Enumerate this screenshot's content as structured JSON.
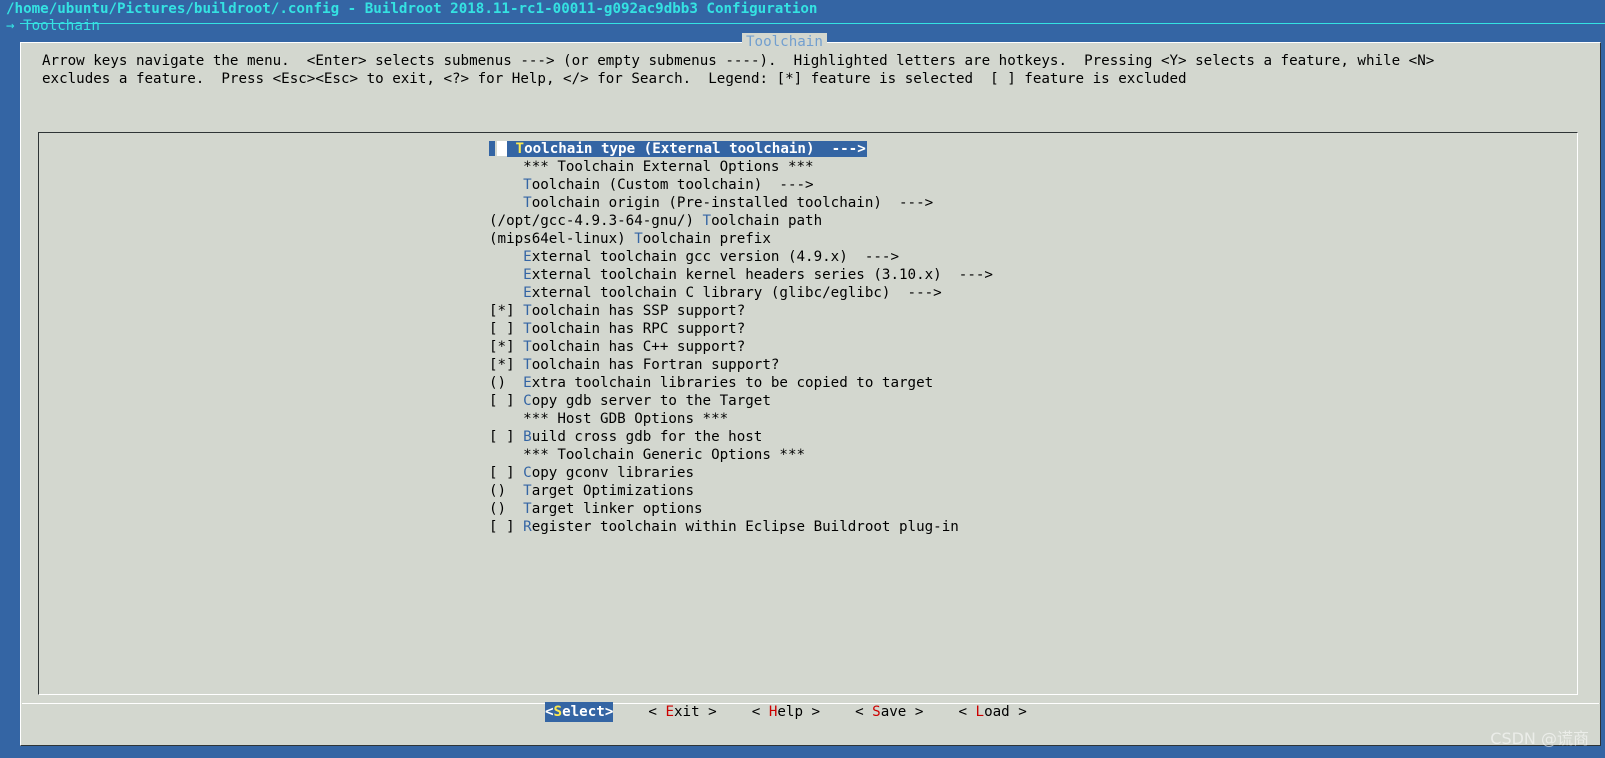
{
  "window": {
    "title": "/home/ubuntu/Pictures/buildroot/.config - Buildroot 2018.11-rc1-00011-g092ac9dbb3 Configuration",
    "breadcrumb": "→ Toolchain"
  },
  "dialog": {
    "title": "Toolchain",
    "help_line_1": "Arrow keys navigate the menu.  <Enter> selects submenus ---> (or empty submenus ----).  Highlighted letters are hotkeys.  Pressing <Y> selects a feature, while <N>",
    "help_line_2": "excludes a feature.  Press <Esc><Esc> to exit, <?> for Help, </> for Search.  Legend: [*] feature is selected  [ ] feature is excluded"
  },
  "menu": {
    "items": [
      {
        "prefix": "    ",
        "hotkey": "T",
        "rest": "oolchain type (External toolchain)  --->",
        "selected": true
      },
      {
        "prefix": "    ",
        "hotkey": "",
        "rest": "*** Toolchain External Options ***"
      },
      {
        "prefix": "    ",
        "hotkey": "T",
        "rest": "oolchain (Custom toolchain)  --->"
      },
      {
        "prefix": "    ",
        "hotkey": "T",
        "rest": "oolchain origin (Pre-installed toolchain)  --->"
      },
      {
        "prefix": "(/opt/gcc-4.9.3-64-gnu/) ",
        "hotkey": "T",
        "rest": "oolchain path"
      },
      {
        "prefix": "(mips64el-linux) ",
        "hotkey": "T",
        "rest": "oolchain prefix"
      },
      {
        "prefix": "    ",
        "hotkey": "E",
        "rest": "xternal toolchain gcc version (4.9.x)  --->"
      },
      {
        "prefix": "    ",
        "hotkey": "E",
        "rest": "xternal toolchain kernel headers series (3.10.x)  --->"
      },
      {
        "prefix": "    ",
        "hotkey": "E",
        "rest": "xternal toolchain C library (glibc/eglibc)  --->"
      },
      {
        "prefix": "[*] ",
        "hotkey": "T",
        "rest": "oolchain has SSP support?"
      },
      {
        "prefix": "[ ] ",
        "hotkey": "T",
        "rest": "oolchain has RPC support?"
      },
      {
        "prefix": "[*] ",
        "hotkey": "T",
        "rest": "oolchain has C++ support?"
      },
      {
        "prefix": "[*] ",
        "hotkey": "T",
        "rest": "oolchain has Fortran support?"
      },
      {
        "prefix": "()  ",
        "hotkey": "E",
        "rest": "xtra toolchain libraries to be copied to target"
      },
      {
        "prefix": "[ ] ",
        "hotkey": "C",
        "rest": "opy gdb server to the Target"
      },
      {
        "prefix": "    ",
        "hotkey": "",
        "rest": "*** Host GDB Options ***"
      },
      {
        "prefix": "[ ] ",
        "hotkey": "B",
        "rest": "uild cross gdb for the host"
      },
      {
        "prefix": "    ",
        "hotkey": "",
        "rest": "*** Toolchain Generic Options ***"
      },
      {
        "prefix": "[ ] ",
        "hotkey": "C",
        "rest": "opy gconv libraries"
      },
      {
        "prefix": "()  ",
        "hotkey": "T",
        "rest": "arget Optimizations"
      },
      {
        "prefix": "()  ",
        "hotkey": "T",
        "rest": "arget linker options"
      },
      {
        "prefix": "[ ] ",
        "hotkey": "R",
        "rest": "egister toolchain within Eclipse Buildroot plug-in"
      }
    ]
  },
  "buttons": [
    {
      "left": "<",
      "hotkey": "S",
      "rest": "elect",
      "right": ">",
      "selected": true
    },
    {
      "left": "< ",
      "hotkey": "E",
      "rest": "xit",
      "right": " >"
    },
    {
      "left": "< ",
      "hotkey": "H",
      "rest": "elp",
      "right": " >"
    },
    {
      "left": "< ",
      "hotkey": "S",
      "rest": "ave",
      "right": " >"
    },
    {
      "left": "< ",
      "hotkey": "L",
      "rest": "oad",
      "right": " >"
    }
  ],
  "watermark": "CSDN @谎商",
  "colors": {
    "background": "#3465a4",
    "dialog": "#d3d7cf",
    "hotkey": "#3465a4",
    "selected_hotkey": "#fce94f",
    "button_hotkey": "#cc0000",
    "title_text": "#34e2e2"
  }
}
